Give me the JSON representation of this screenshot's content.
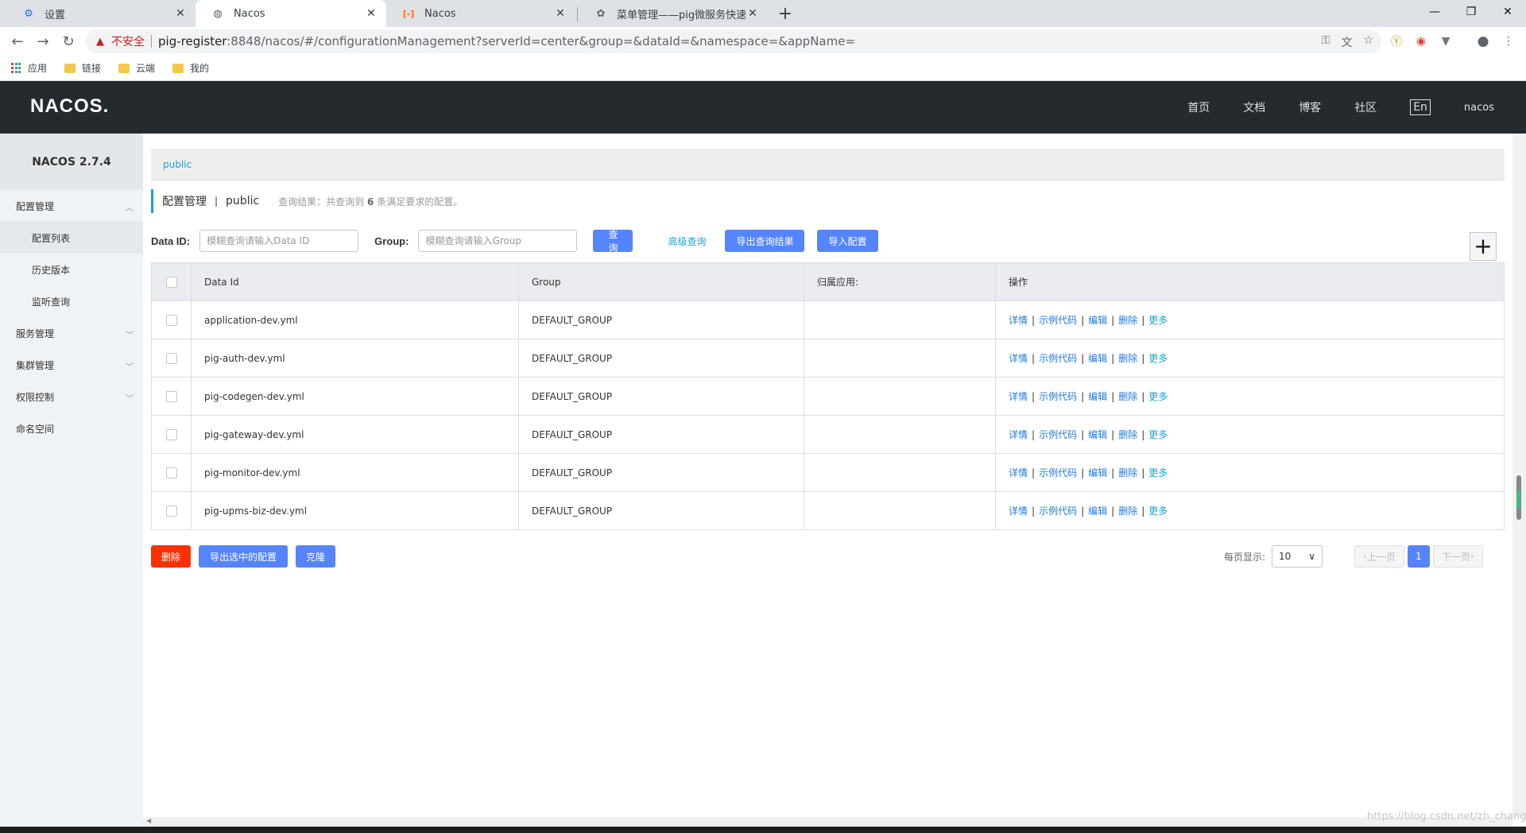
{
  "browser": {
    "tabs": [
      {
        "title": "设置",
        "icon": "gear-icon",
        "active": false
      },
      {
        "title": "Nacos",
        "icon": "globe-icon",
        "active": true
      },
      {
        "title": "Nacos",
        "icon": "nacos-logo-icon",
        "active": false
      },
      {
        "title": "菜单管理——pig微服务快速开发",
        "icon": "pig-logo-icon",
        "active": false
      }
    ],
    "security_label": "不安全",
    "url_host": "pig-register",
    "url_path": ":8848/nacos/#/configurationManagement?serverId=center&group=&dataId=&namespace=&appName=",
    "bookmarks": [
      {
        "label": "应用",
        "icon": "apps-icon"
      },
      {
        "label": "链接",
        "icon": "folder-icon"
      },
      {
        "label": "云端",
        "icon": "folder-icon"
      },
      {
        "label": "我的",
        "icon": "folder-icon"
      }
    ]
  },
  "header": {
    "logo": "NACOS.",
    "nav": [
      "首页",
      "文档",
      "博客",
      "社区"
    ],
    "lang": "En",
    "user": "nacos"
  },
  "sidebar": {
    "title": "NACOS 2.7.4",
    "items": [
      {
        "label": "配置管理",
        "type": "group",
        "expanded": true
      },
      {
        "label": "配置列表",
        "type": "sub",
        "active": true
      },
      {
        "label": "历史版本",
        "type": "sub"
      },
      {
        "label": "监听查询",
        "type": "sub"
      },
      {
        "label": "服务管理",
        "type": "group",
        "expanded": false
      },
      {
        "label": "集群管理",
        "type": "group",
        "expanded": false
      },
      {
        "label": "权限控制",
        "type": "group",
        "expanded": false
      },
      {
        "label": "命名空间",
        "type": "item"
      }
    ]
  },
  "main": {
    "namespace_tab": "public",
    "title": "配置管理",
    "namespace": "public",
    "result_prefix": "查询结果：共查询到",
    "result_count": "6",
    "result_suffix": "条满足要求的配置。",
    "filter": {
      "dataid_label": "Data ID:",
      "dataid_placeholder": "模糊查询请输入Data ID",
      "group_label": "Group:",
      "group_placeholder": "模糊查询请输入Group",
      "query_btn": "查询",
      "advanced_btn": "高级查询",
      "export_btn": "导出查询结果",
      "import_btn": "导入配置"
    },
    "table": {
      "columns": [
        "Data Id",
        "Group",
        "归属应用:",
        "操作"
      ],
      "ops": [
        "详情",
        "示例代码",
        "编辑",
        "删除",
        "更多"
      ],
      "rows": [
        {
          "data_id": "application-dev.yml",
          "group": "DEFAULT_GROUP",
          "app": ""
        },
        {
          "data_id": "pig-auth-dev.yml",
          "group": "DEFAULT_GROUP",
          "app": ""
        },
        {
          "data_id": "pig-codegen-dev.yml",
          "group": "DEFAULT_GROUP",
          "app": ""
        },
        {
          "data_id": "pig-gateway-dev.yml",
          "group": "DEFAULT_GROUP",
          "app": ""
        },
        {
          "data_id": "pig-monitor-dev.yml",
          "group": "DEFAULT_GROUP",
          "app": ""
        },
        {
          "data_id": "pig-upms-biz-dev.yml",
          "group": "DEFAULT_GROUP",
          "app": ""
        }
      ]
    },
    "footer": {
      "delete_btn": "删除",
      "export_selected_btn": "导出选中的配置",
      "clone_btn": "克隆",
      "page_size_label": "每页显示:",
      "page_size": "10",
      "prev": "上一页",
      "current_page": "1",
      "next": "下一页"
    }
  },
  "watermark": "https://blog.csdn.net/zh_chang",
  "colors": {
    "header_bg": "#252a2f",
    "primary": "#5584ff",
    "danger": "#ff3000",
    "link": "#1aa3d9"
  }
}
